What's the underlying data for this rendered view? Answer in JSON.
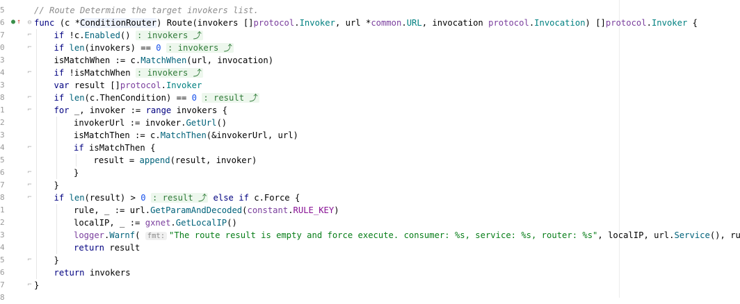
{
  "gutter": {
    "line_numbers": [
      "5",
      "6",
      "7",
      "0",
      "3",
      "4",
      "3",
      "8",
      "1",
      "2",
      "3",
      "4",
      "5",
      "6",
      "7",
      "8",
      "1",
      "2",
      "3",
      "4",
      "5",
      "6",
      "7",
      "8"
    ],
    "override_markers": {
      "green": "●",
      "red": "↑"
    }
  },
  "code": {
    "lines": [
      {
        "indent": 0,
        "segments": [
          {
            "t": "// Route Determine the target invokers list.",
            "c": "cm"
          }
        ]
      },
      {
        "indent": 0,
        "segments": [
          {
            "t": "func",
            "c": "kw"
          },
          {
            "t": " (c *",
            "c": ""
          },
          {
            "t": "ConditionRouter",
            "c": "hl"
          },
          {
            "t": ") Route(invokers []",
            "c": ""
          },
          {
            "t": "protocol",
            "c": "ty"
          },
          {
            "t": ".",
            "c": ""
          },
          {
            "t": "Invoker",
            "c": "pk"
          },
          {
            "t": ", url *",
            "c": ""
          },
          {
            "t": "common",
            "c": "ty"
          },
          {
            "t": ".",
            "c": ""
          },
          {
            "t": "URL",
            "c": "pk"
          },
          {
            "t": ", invocation ",
            "c": ""
          },
          {
            "t": "protocol",
            "c": "ty"
          },
          {
            "t": ".",
            "c": ""
          },
          {
            "t": "Invocation",
            "c": "pk"
          },
          {
            "t": ") []",
            "c": ""
          },
          {
            "t": "protocol",
            "c": "ty"
          },
          {
            "t": ".",
            "c": ""
          },
          {
            "t": "Invoker",
            "c": "pk"
          },
          {
            "t": " {",
            "c": ""
          }
        ]
      },
      {
        "indent": 1,
        "segments": [
          {
            "t": "if",
            "c": "kw"
          },
          {
            "t": " !c.",
            "c": ""
          },
          {
            "t": "Enabled",
            "c": "fn"
          },
          {
            "t": "() ",
            "c": ""
          },
          {
            "t": ": invokers ⤴",
            "c": "hint"
          }
        ]
      },
      {
        "indent": 1,
        "segments": [
          {
            "t": "if",
            "c": "kw"
          },
          {
            "t": " ",
            "c": ""
          },
          {
            "t": "len",
            "c": "fn"
          },
          {
            "t": "(invokers) == ",
            "c": ""
          },
          {
            "t": "0",
            "c": "num"
          },
          {
            "t": " ",
            "c": ""
          },
          {
            "t": ": invokers ⤴",
            "c": "hint"
          }
        ]
      },
      {
        "indent": 1,
        "segments": [
          {
            "t": "isMatchWhen := c.",
            "c": ""
          },
          {
            "t": "MatchWhen",
            "c": "fn"
          },
          {
            "t": "(url, invocation)",
            "c": ""
          }
        ]
      },
      {
        "indent": 1,
        "segments": [
          {
            "t": "if",
            "c": "kw"
          },
          {
            "t": " !isMatchWhen ",
            "c": ""
          },
          {
            "t": ": invokers ⤴",
            "c": "hint"
          }
        ]
      },
      {
        "indent": 1,
        "segments": [
          {
            "t": "var",
            "c": "kw"
          },
          {
            "t": " result []",
            "c": ""
          },
          {
            "t": "protocol",
            "c": "ty"
          },
          {
            "t": ".",
            "c": ""
          },
          {
            "t": "Invoker",
            "c": "pk"
          }
        ]
      },
      {
        "indent": 1,
        "segments": [
          {
            "t": "if",
            "c": "kw"
          },
          {
            "t": " ",
            "c": ""
          },
          {
            "t": "len",
            "c": "fn"
          },
          {
            "t": "(c.ThenCondition) == ",
            "c": ""
          },
          {
            "t": "0",
            "c": "num"
          },
          {
            "t": " ",
            "c": ""
          },
          {
            "t": ": result ⤴",
            "c": "hint"
          }
        ]
      },
      {
        "indent": 1,
        "segments": [
          {
            "t": "for",
            "c": "kw"
          },
          {
            "t": " _, invoker := ",
            "c": ""
          },
          {
            "t": "range",
            "c": "kw"
          },
          {
            "t": " invokers {",
            "c": ""
          }
        ]
      },
      {
        "indent": 2,
        "segments": [
          {
            "t": "invokerUrl := invoker.",
            "c": ""
          },
          {
            "t": "GetUrl",
            "c": "fn"
          },
          {
            "t": "()",
            "c": ""
          }
        ]
      },
      {
        "indent": 2,
        "segments": [
          {
            "t": "isMatchThen := c.",
            "c": ""
          },
          {
            "t": "MatchThen",
            "c": "fn"
          },
          {
            "t": "(&invokerUrl, url)",
            "c": ""
          }
        ]
      },
      {
        "indent": 2,
        "segments": [
          {
            "t": "if",
            "c": "kw"
          },
          {
            "t": " isMatchThen {",
            "c": ""
          }
        ]
      },
      {
        "indent": 3,
        "segments": [
          {
            "t": "result = ",
            "c": ""
          },
          {
            "t": "append",
            "c": "fn"
          },
          {
            "t": "(result, invoker)",
            "c": ""
          }
        ]
      },
      {
        "indent": 2,
        "segments": [
          {
            "t": "}",
            "c": ""
          }
        ]
      },
      {
        "indent": 1,
        "segments": [
          {
            "t": "}",
            "c": ""
          }
        ]
      },
      {
        "indent": 1,
        "segments": [
          {
            "t": "if",
            "c": "kw"
          },
          {
            "t": " ",
            "c": ""
          },
          {
            "t": "len",
            "c": "fn"
          },
          {
            "t": "(result) > ",
            "c": ""
          },
          {
            "t": "0",
            "c": "num"
          },
          {
            "t": " ",
            "c": ""
          },
          {
            "t": ": result ⤴",
            "c": "hint"
          },
          {
            "t": " ",
            "c": ""
          },
          {
            "t": "else",
            "c": "kw"
          },
          {
            "t": " ",
            "c": ""
          },
          {
            "t": "if",
            "c": "kw"
          },
          {
            "t": " c.Force {",
            "c": ""
          }
        ]
      },
      {
        "indent": 2,
        "segments": [
          {
            "t": "rule, _ := url.",
            "c": ""
          },
          {
            "t": "GetParamAndDecoded",
            "c": "fn"
          },
          {
            "t": "(",
            "c": ""
          },
          {
            "t": "constant",
            "c": "ty"
          },
          {
            "t": ".",
            "c": ""
          },
          {
            "t": "RULE_KEY",
            "c": "const"
          },
          {
            "t": ")",
            "c": ""
          }
        ]
      },
      {
        "indent": 2,
        "segments": [
          {
            "t": "localIP, _ := ",
            "c": ""
          },
          {
            "t": "gxnet",
            "c": "ty"
          },
          {
            "t": ".",
            "c": ""
          },
          {
            "t": "GetLocalIP",
            "c": "fn"
          },
          {
            "t": "()",
            "c": ""
          }
        ]
      },
      {
        "indent": 2,
        "segments": [
          {
            "t": "logger",
            "c": "ty"
          },
          {
            "t": ".",
            "c": ""
          },
          {
            "t": "Warnf",
            "c": "fn"
          },
          {
            "t": "( ",
            "c": ""
          },
          {
            "t": "fmt:",
            "c": "param-hint"
          },
          {
            "t": "\"The route result is empty and force execute. consumer: %s, service: %s, router: %s\"",
            "c": "str"
          },
          {
            "t": ", localIP, url.",
            "c": ""
          },
          {
            "t": "Service",
            "c": "fn"
          },
          {
            "t": "(), rule)",
            "c": ""
          }
        ]
      },
      {
        "indent": 2,
        "segments": [
          {
            "t": "return",
            "c": "kw"
          },
          {
            "t": " result",
            "c": ""
          }
        ]
      },
      {
        "indent": 1,
        "segments": [
          {
            "t": "}",
            "c": ""
          }
        ]
      },
      {
        "indent": 1,
        "segments": [
          {
            "t": "return",
            "c": "kw"
          },
          {
            "t": " invokers",
            "c": ""
          }
        ]
      },
      {
        "indent": 0,
        "segments": [
          {
            "t": "}",
            "c": ""
          }
        ]
      },
      {
        "indent": 0,
        "segments": []
      }
    ]
  },
  "colors": {
    "keyword": "#000080",
    "function": "#00627a",
    "package": "#7a3e9d",
    "type": "#008080",
    "string": "#067d17",
    "number": "#1750eb",
    "comment": "#8c8c8c",
    "inlay_hint_bg": "#edf7ed"
  }
}
